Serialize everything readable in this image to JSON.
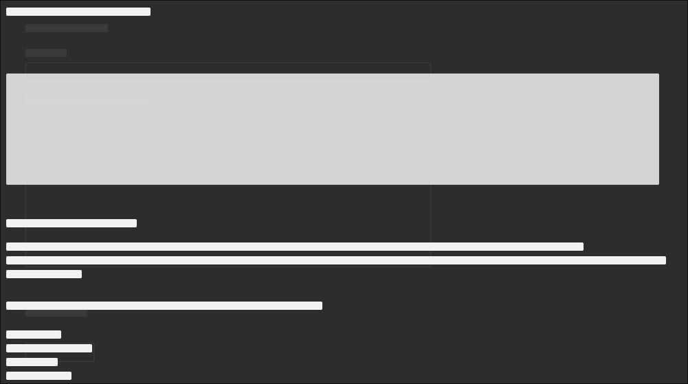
{
  "window": {
    "background": "#2d2d2d",
    "text_color": "#f2f2f2"
  }
}
